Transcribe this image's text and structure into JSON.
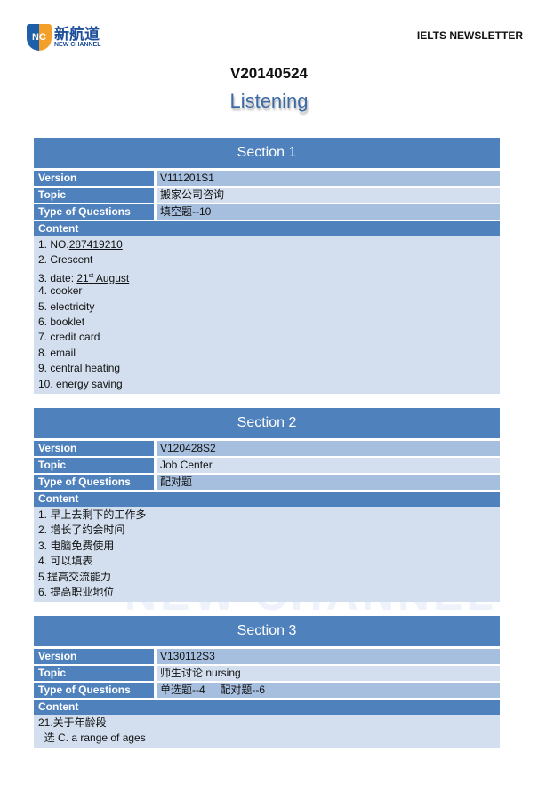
{
  "header": {
    "logo_cn": "新航道",
    "logo_en": "NEW CHANNEL",
    "logo_mark": "NC",
    "newsletter": "IELTS NEWSLETTER",
    "issue": "V20140524",
    "subject": "Listening"
  },
  "labels": {
    "version": "Version",
    "topic": "Topic",
    "type": "Type of Questions",
    "content": "Content"
  },
  "watermark": "NEW CHANNEL",
  "sections": [
    {
      "title": "Section 1",
      "version": "V111201S1",
      "topic": "搬家公司咨询",
      "type": "填空题--10",
      "content": [
        {
          "pre": "1. NO.",
          "u": "287419210"
        },
        {
          "pre": "2. Crescent"
        },
        {
          "pre": "3. date: ",
          "u": "21",
          "sup": "st",
          "u2": " August"
        },
        {
          "pre": "4. cooker"
        },
        {
          "pre": "5. electricity"
        },
        {
          "pre": "6. booklet"
        },
        {
          "pre": "7. credit card"
        },
        {
          "pre": "8. email"
        },
        {
          "pre": "9. central heating"
        },
        {
          "pre": "10. energy saving"
        }
      ]
    },
    {
      "title": "Section 2",
      "version": "V120428S2",
      "topic": "Job Center",
      "type": "配对题",
      "content": [
        {
          "pre": "1. 早上去剩下的工作多"
        },
        {
          "pre": "2. 增长了约会时间"
        },
        {
          "pre": "3. 电脑免费使用"
        },
        {
          "pre": "4. 可以填表"
        },
        {
          "pre": "5.提高交流能力"
        },
        {
          "pre": "6. 提高职业地位"
        }
      ]
    },
    {
      "title": "Section 3",
      "version": "V130112S3",
      "topic": "师生讨论 nursing",
      "type": "单选题--4     配对题--6",
      "content": [
        {
          "pre": "21.关于年龄段"
        },
        {
          "pre": "  选 C. a range of ages"
        }
      ]
    }
  ]
}
